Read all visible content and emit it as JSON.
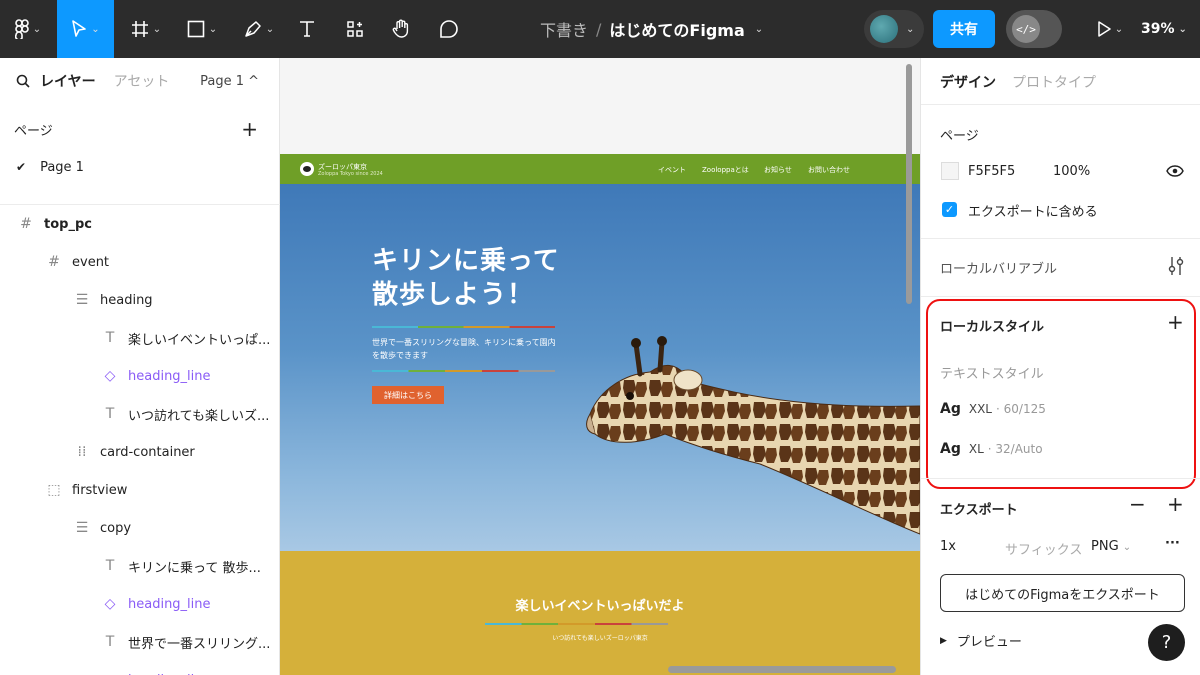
{
  "toolbar": {
    "breadcrumb_parent": "下書き",
    "breadcrumb_sep": "/",
    "file_name": "はじめてのFigma",
    "share_label": "共有",
    "dev_mode_label": "</>",
    "zoom": "39%",
    "accent": "#0d99ff"
  },
  "left_panel": {
    "tab_layers": "レイヤー",
    "tab_assets": "アセット",
    "page_selector": "Page 1 ^",
    "pages_label": "ページ",
    "add_page": "+",
    "current_page": "Page 1",
    "layers": [
      {
        "name": "top_pc",
        "icon": "frame-icon",
        "bold": true
      },
      {
        "name": "event",
        "icon": "frame-icon"
      },
      {
        "name": "heading",
        "icon": "auto-layout-icon"
      },
      {
        "name": "楽しいイベントいっぱ...",
        "icon": "text-icon"
      },
      {
        "name": "heading_line",
        "icon": "component-instance-icon",
        "color": "#8a5cf6"
      },
      {
        "name": "いつ訪れても楽しいズ...",
        "icon": "text-icon"
      },
      {
        "name": "card-container",
        "icon": "grid-icon"
      },
      {
        "name": "firstview",
        "icon": "section-dashed-icon"
      },
      {
        "name": "copy",
        "icon": "auto-layout-icon"
      },
      {
        "name": "キリンに乗って 散歩...",
        "icon": "text-icon"
      },
      {
        "name": "heading_line",
        "icon": "component-instance-icon",
        "color": "#8a5cf6"
      },
      {
        "name": "世界で一番スリリング...",
        "icon": "text-icon"
      },
      {
        "name": "heading_line",
        "icon": "component-instance-icon",
        "color": "#8a5cf6"
      }
    ]
  },
  "canvas": {
    "site_brand": "ズーロッパ東京",
    "site_brand_sub": "Zoloppa Tokyo since 2024",
    "nav": [
      "イベント",
      "Zooloppaとは",
      "お知らせ",
      "お問い合わせ"
    ],
    "hero_title_1": "キリンに乗って",
    "hero_title_2": "散歩しよう！",
    "hero_copy": "世界で一番スリリングな冒険、キリンに乗って園内を散歩できます",
    "hero_button": "詳細はこちら",
    "event_title": "楽しいイベントいっぱいだよ",
    "event_sub": "いつ訪れても楽しいズーロッパ東京",
    "header_color": "#6f9f27",
    "event_color": "#d5b03a",
    "button_color": "#e0622f"
  },
  "right_panel": {
    "tab_design": "デザイン",
    "tab_prototype": "プロトタイプ",
    "page_section": "ページ",
    "bg_color": "F5F5F5",
    "bg_opacity": "100%",
    "include_export": "エクスポートに含める",
    "local_variables": "ローカルバリアブル",
    "local_styles": "ローカルスタイル",
    "text_styles": "テキストスタイル",
    "styles": [
      {
        "prefix": "Ag",
        "name": "XXL",
        "meta": "· 60/125"
      },
      {
        "prefix": "Ag",
        "name": "XL",
        "meta": "· 32/Auto"
      }
    ],
    "export_section": "エクスポート",
    "export_scale": "1x",
    "export_suffix_placeholder": "サフィックス",
    "export_format": "PNG",
    "export_more": "···",
    "export_button": "はじめてのFigmaをエクスポート",
    "preview": "プレビュー",
    "help": "?"
  }
}
